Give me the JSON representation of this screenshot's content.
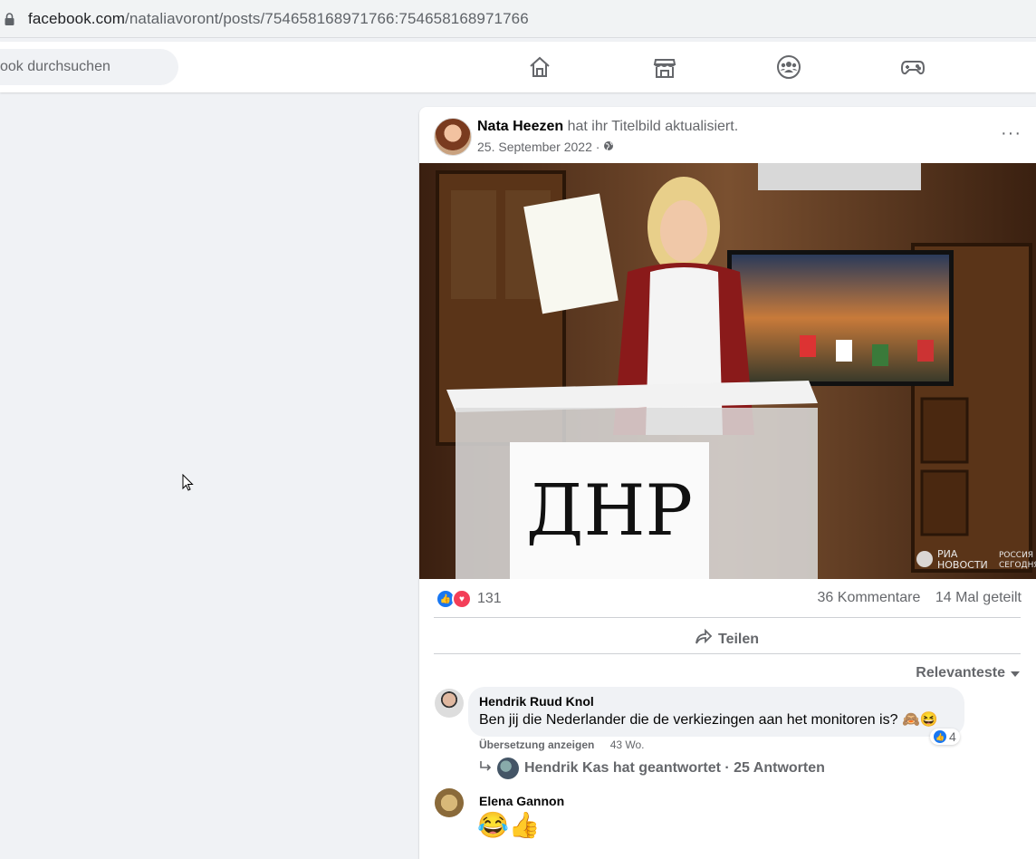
{
  "browser": {
    "url_domain": "facebook.com",
    "url_path": "/nataliavoront/posts/754658168971766:754658168971766"
  },
  "topnav": {
    "search_placeholder": "ook durchsuchen",
    "icons": [
      "home-icon",
      "marketplace-icon",
      "groups-icon",
      "gaming-icon"
    ]
  },
  "post": {
    "author": "Nata Heezen",
    "action": "hat ihr Titelbild aktualisiert.",
    "date": "25. September 2022 ·",
    "more_label": "···",
    "photo": {
      "sign_text": "ДНР",
      "watermark_line1": "РИА",
      "watermark_line2": "НОВОСТИ",
      "watermark_line3": "РОССИЯ",
      "watermark_line4": "СЕГОДНЯ"
    },
    "reaction_count": "131",
    "comments_count": "36 Kommentare",
    "shares_count": "14 Mal geteilt",
    "share_label": "Teilen",
    "sort_label": "Relevanteste"
  },
  "comments": [
    {
      "name": "Hendrik Ruud Knol",
      "text": "Ben jij die Nederlander die de verkiezingen aan het monitoren is? 🙈😆",
      "likes": "4",
      "translate": "Übersetzung anzeigen",
      "age": "43 Wo.",
      "reply_summary": "Hendrik Kas hat geantwortet · 25 Antworten"
    },
    {
      "name": "Elena Gannon",
      "text": "😂👍"
    }
  ]
}
